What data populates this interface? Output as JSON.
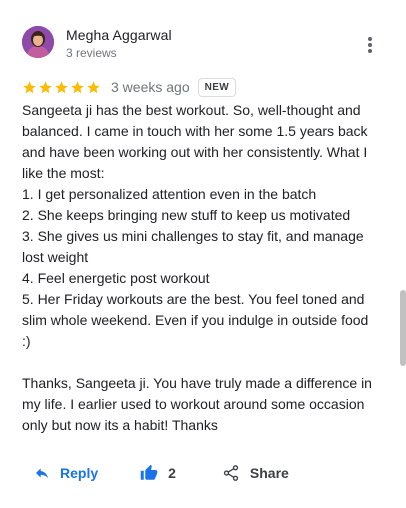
{
  "author": {
    "name": "Megha Aggarwal",
    "meta": "3 reviews",
    "avatar_icon": "avatar-photo"
  },
  "rating": {
    "stars": 5,
    "max": 5,
    "star_color": "#fbbc04",
    "date": "3 weeks ago",
    "badge": "NEW"
  },
  "review": {
    "text": "Sangeeta ji has the best workout. So, well-thought and balanced. I came in touch with her some 1.5 years back and have been working out with her consistently. What I like the most:\n1. I get personalized attention even in the batch\n2. She keeps bringing new stuff to keep us motivated\n3. She gives us mini challenges to stay fit, and manage lost weight\n4. Feel energetic post workout\n5. Her Friday workouts are the best. You feel toned and slim whole weekend. Even if you indulge in outside food :)\n\nThanks, Sangeeta ji. You have truly made a difference in my life. I earlier used to workout around some occasion only but now its a habit! Thanks"
  },
  "actions": {
    "reply_label": "Reply",
    "like_count": "2",
    "share_label": "Share",
    "accent": "#1a73e8"
  }
}
